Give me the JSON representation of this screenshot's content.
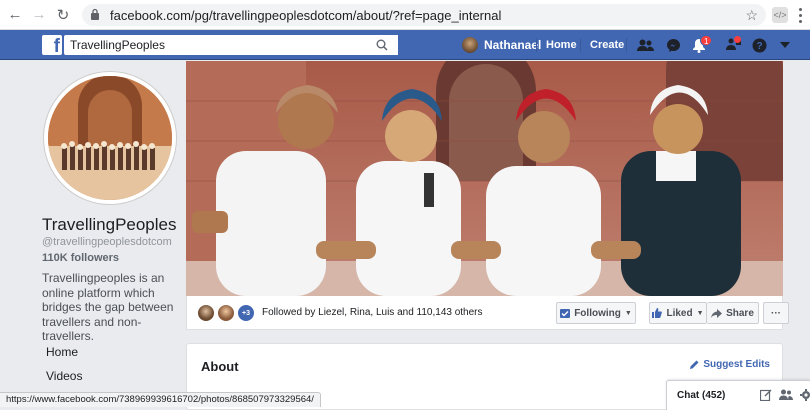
{
  "browser": {
    "url": "facebook.com/pg/travellingpeoplesdotcom/about/?ref=page_internal",
    "status_url": "https://www.facebook.com/738969939616702/photos/868507973329564/"
  },
  "header": {
    "search_value": "TravellingPeoples",
    "user_name": "Nathanael",
    "home_label": "Home",
    "create_label": "Create",
    "notification_count": "1"
  },
  "page": {
    "name": "TravellingPeoples",
    "handle": "@travellingpeoplesdotcom",
    "followers": "110K followers",
    "bio": "Travellingpeoples is an online platform which bridges the gap between travellers and non-travellers."
  },
  "left_nav": [
    {
      "label": "Home"
    },
    {
      "label": "Videos"
    }
  ],
  "follow_bar": {
    "extra_count": "+3",
    "followed_by_text": "Followed by Liezel, Rina, Luis and 110,143 others",
    "following_label": "Following",
    "liked_label": "Liked",
    "share_label": "Share",
    "more_label": "···"
  },
  "about": {
    "title": "About",
    "suggest_edits": "Suggest Edits"
  },
  "chat": {
    "label": "Chat (452)"
  },
  "colors": {
    "facebook_blue": "#4267b2",
    "notification_red": "#fa3e3e"
  }
}
